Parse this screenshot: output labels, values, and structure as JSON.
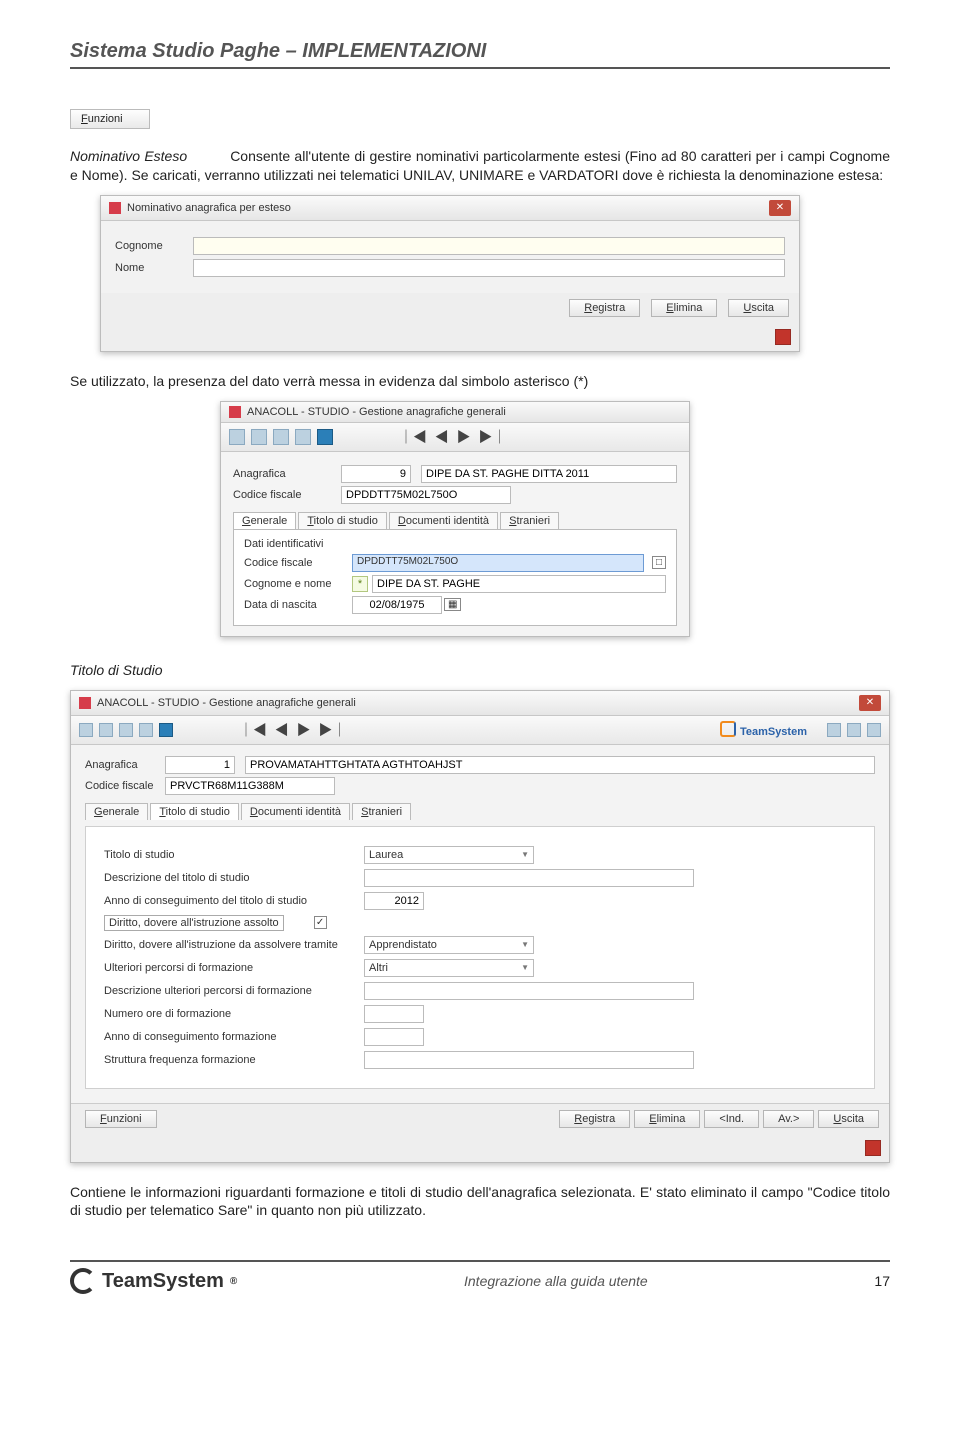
{
  "doc": {
    "header": "Sistema Studio Paghe – IMPLEMENTAZIONI",
    "footer_center": "Integrazione alla guida utente",
    "footer_page": "17",
    "footer_brand": "TeamSystem"
  },
  "funzioni_btn": "Funzioni",
  "para1_term": "Nominativo Esteso",
  "para1_rest": "Consente all'utente di gestire nominativi particolarmente estesi (Fino ad 80 caratteri per i campi Cognome e Nome). Se caricati, verranno utilizzati nei telematici UNILAV, UNIMARE e VARDATORI dove è richiesta la denominazione estesa:",
  "win1": {
    "title": "Nominativo anagrafica per esteso",
    "cognome_lbl": "Cognome",
    "nome_lbl": "Nome",
    "btn_reg": "Registra",
    "btn_el": "Elimina",
    "btn_us": "Uscita"
  },
  "para2": "Se utilizzato, la presenza del dato verrà messa in evidenza dal simbolo asterisco (*)",
  "win2": {
    "title": "ANACOLL  - STUDIO - Gestione anagrafiche generali",
    "anag_lbl": "Anagrafica",
    "anag_val": "9",
    "anag_desc": "DIPE DA ST. PAGHE DITTA 2011",
    "cf_lbl": "Codice fiscale",
    "cf_val": "DPDDTT75M02L750O",
    "tab_gen": "Generale",
    "tab_tit": "Titolo di studio",
    "tab_doc": "Documenti identità",
    "tab_str": "Stranieri",
    "grp": "Dati identificativi",
    "cf2_lbl": "Codice fiscale",
    "cf2_val": "DPDDTT75M02L750O",
    "cogn_lbl": "Cognome e nome",
    "cogn_val": "DIPE DA ST. PAGHE",
    "dn_lbl": "Data di nascita",
    "dn_val": "02/08/1975"
  },
  "section_title": "Titolo di Studio",
  "win3": {
    "title": "ANACOLL  - STUDIO - Gestione anagrafiche generali",
    "brand": "TeamSystem",
    "anag_lbl": "Anagrafica",
    "anag_val": "1",
    "anag_desc": "PROVAMATAHTTGHTATA AGTHTOAHJST",
    "cf_lbl": "Codice fiscale",
    "cf_val": "PRVCTR68M11G388M",
    "tab_gen": "Generale",
    "tab_tit": "Titolo di studio",
    "tab_doc": "Documenti identità",
    "tab_str": "Stranieri",
    "f_titolo_lbl": "Titolo di studio",
    "f_titolo_val": "Laurea",
    "f_descr_lbl": "Descrizione del titolo di studio",
    "f_anno_lbl": "Anno di conseguimento del titolo di studio",
    "f_anno_val": "2012",
    "f_dir_ass_lbl": "Diritto, dovere all'istruzione assolto",
    "f_dir_tram_lbl": "Diritto, dovere all'istruzione da assolvere tramite",
    "f_dir_tram_val": "Apprendistato",
    "f_ult_lbl": "Ulteriori percorsi di formazione",
    "f_ult_val": "Altri",
    "f_descr_ult_lbl": "Descrizione ulteriori percorsi di formazione",
    "f_numore_lbl": "Numero ore di formazione",
    "f_annoform_lbl": "Anno di conseguimento formazione",
    "f_strutt_lbl": "Struttura frequenza formazione",
    "btn_fun": "Funzioni",
    "btn_reg": "Registra",
    "btn_el": "Elimina",
    "btn_ind": "<Ind.",
    "btn_av": "Av.>",
    "btn_us": "Uscita"
  },
  "para3": "Contiene le informazioni riguardanti formazione e titoli di studio dell'anagrafica selezionata. E' stato eliminato il campo \"Codice titolo di studio per telematico Sare\" in quanto non più utilizzato."
}
